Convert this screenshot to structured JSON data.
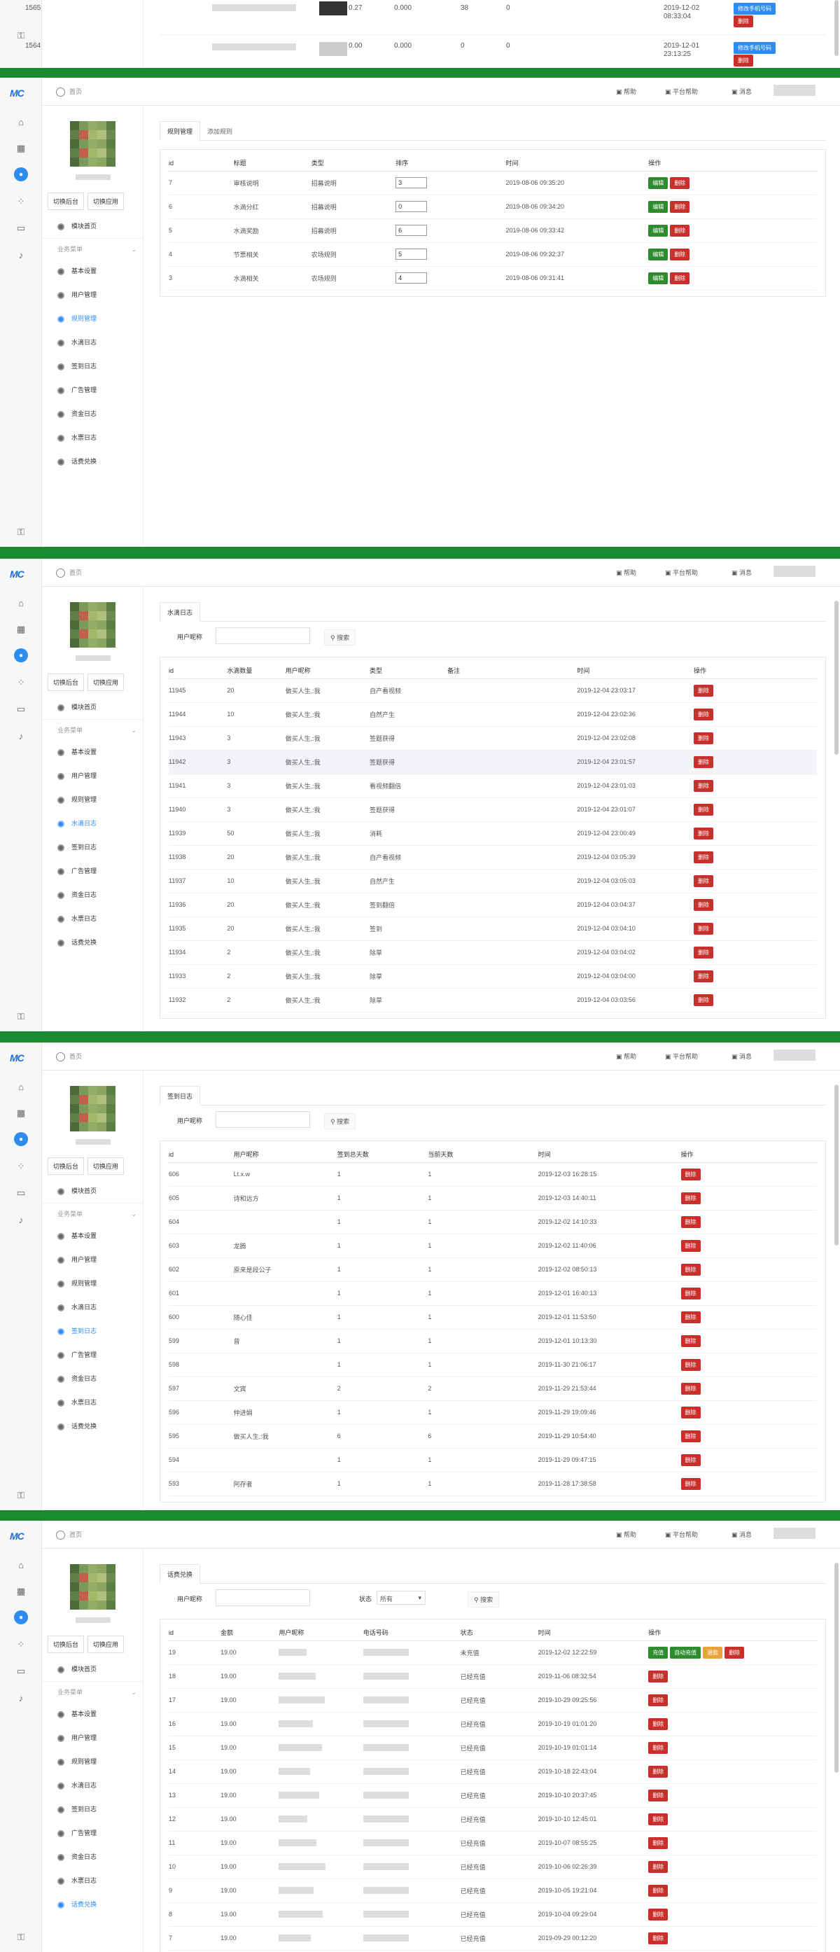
{
  "common": {
    "logo": "MC",
    "home": "首页",
    "help": "帮助",
    "platform_help": "平台帮助",
    "messages": "消息",
    "switch_frame": "切换后台",
    "switch_app": "切换应用",
    "module_list": "模块首页",
    "business_menu": "业务菜单",
    "menu": [
      "基本设置",
      "用户管理",
      "规则管理",
      "水滴日志",
      "签到日志",
      "广告管理",
      "资金日志",
      "水票日志",
      "话费兑换"
    ]
  },
  "top_strip": {
    "rows": [
      {
        "id": "1565",
        "c3": "0.27",
        "c4": "0.000",
        "c5": "38",
        "c6": "0",
        "date": "2019-12-02",
        "time": "08:33:04",
        "btn1": "修改手机号码",
        "btn2": "删除"
      },
      {
        "id": "1564",
        "c3": "0.00",
        "c4": "0.000",
        "c5": "0",
        "c6": "0",
        "date": "2019-12-01",
        "time": "23:13:25",
        "btn1": "修改手机号码",
        "btn2": "删除"
      }
    ]
  },
  "rules": {
    "tabs": [
      "规则管理",
      "添加规则"
    ],
    "headers": [
      "id",
      "标题",
      "类型",
      "排序",
      "时间",
      "操作"
    ],
    "rows": [
      {
        "id": "7",
        "title": "审核说明",
        "type": "招募说明",
        "sort": "3",
        "time": "2019-08-06 09:35:20"
      },
      {
        "id": "6",
        "title": "水滴分红",
        "type": "招募说明",
        "sort": "0",
        "time": "2019-08-06 09:34:20"
      },
      {
        "id": "5",
        "title": "水滴奖励",
        "type": "招募说明",
        "sort": "6",
        "time": "2019-08-06 09:33:42"
      },
      {
        "id": "4",
        "title": "节票相关",
        "type": "农场规则",
        "sort": "5",
        "time": "2019-08-06 09:32:37"
      },
      {
        "id": "3",
        "title": "水滴相关",
        "type": "农场规则",
        "sort": "4",
        "time": "2019-08-06 09:31:41"
      }
    ],
    "edit": "编辑",
    "del": "删除"
  },
  "waterlog": {
    "tab": "水滴日志",
    "search_label": "用户昵称",
    "search_btn": "搜索",
    "headers": [
      "id",
      "水滴数量",
      "用户昵称",
      "类型",
      "备注",
      "时间",
      "操作"
    ],
    "rows": [
      {
        "id": "11945",
        "num": "20",
        "user": "做买人生,:我",
        "type": "自产看视频",
        "time": "2019-12-04 23:03:17"
      },
      {
        "id": "11944",
        "num": "10",
        "user": "做买人生,:我",
        "type": "自然产生",
        "time": "2019-12-04 23:02:36"
      },
      {
        "id": "11943",
        "num": "3",
        "user": "做买人生,:我",
        "type": "签题获得",
        "time": "2019-12-04 23:02:08"
      },
      {
        "id": "11942",
        "num": "3",
        "user": "做买人生,:我",
        "type": "签题获得",
        "time": "2019-12-04 23:01:57"
      },
      {
        "id": "11941",
        "num": "3",
        "user": "做买人生,:我",
        "type": "看视频翻倍",
        "time": "2019-12-04 23:01:03"
      },
      {
        "id": "11940",
        "num": "3",
        "user": "做买人生,:我",
        "type": "签题获得",
        "time": "2019-12-04 23:01:07"
      },
      {
        "id": "11939",
        "num": "50",
        "user": "做买人生,:我",
        "type": "消耗",
        "time": "2019-12-04 23:00:49"
      },
      {
        "id": "11938",
        "num": "20",
        "user": "做买人生,:我",
        "type": "自产看视频",
        "time": "2019-12-04 03:05:39"
      },
      {
        "id": "11937",
        "num": "10",
        "user": "做买人生,:我",
        "type": "自然产生",
        "time": "2019-12-04 03:05:03"
      },
      {
        "id": "11936",
        "num": "20",
        "user": "做买人生,:我",
        "type": "签到翻倍",
        "time": "2019-12-04 03:04:37"
      },
      {
        "id": "11935",
        "num": "20",
        "user": "做买人生,:我",
        "type": "签到",
        "time": "2019-12-04 03:04:10"
      },
      {
        "id": "11934",
        "num": "2",
        "user": "做买人生,:我",
        "type": "除草",
        "time": "2019-12-04 03:04:02"
      },
      {
        "id": "11933",
        "num": "2",
        "user": "做买人生,:我",
        "type": "除草",
        "time": "2019-12-04 03:04:00"
      },
      {
        "id": "11932",
        "num": "2",
        "user": "做买人生,:我",
        "type": "除草",
        "time": "2019-12-04 03:03:56"
      }
    ],
    "del": "删除"
  },
  "signlog": {
    "tab": "签到日志",
    "search_label": "用户昵称",
    "search_btn": "搜索",
    "headers": [
      "id",
      "用户昵称",
      "签到总天数",
      "当前天数",
      "时间",
      "操作"
    ],
    "rows": [
      {
        "id": "606",
        "user": "Lt.x.w",
        "total": "1",
        "cur": "1",
        "time": "2019-12-03 16:28:15"
      },
      {
        "id": "605",
        "user": "诗和远方",
        "total": "1",
        "cur": "1",
        "time": "2019-12-03 14:40:11"
      },
      {
        "id": "604",
        "user": "",
        "total": "1",
        "cur": "1",
        "time": "2019-12-02 14:10:33"
      },
      {
        "id": "603",
        "user": "龙腾",
        "total": "1",
        "cur": "1",
        "time": "2019-12-02 11:40:06"
      },
      {
        "id": "602",
        "user": "原来是段公子",
        "total": "1",
        "cur": "1",
        "time": "2019-12-02 08:50:13"
      },
      {
        "id": "601",
        "user": "",
        "total": "1",
        "cur": "1",
        "time": "2019-12-01 16:40:13"
      },
      {
        "id": "600",
        "user": "随心佳",
        "total": "1",
        "cur": "1",
        "time": "2019-12-01 11:53:50"
      },
      {
        "id": "599",
        "user": "曾",
        "total": "1",
        "cur": "1",
        "time": "2019-12-01 10:13:30"
      },
      {
        "id": "598",
        "user": "",
        "total": "1",
        "cur": "1",
        "time": "2019-11-30 21:06:17"
      },
      {
        "id": "597",
        "user": "文宾",
        "total": "2",
        "cur": "2",
        "time": "2019-11-29 21:53:44"
      },
      {
        "id": "596",
        "user": "仲进娟",
        "total": "1",
        "cur": "1",
        "time": "2019-11-29 19:09:46"
      },
      {
        "id": "595",
        "user": "做买人生,:我",
        "total": "6",
        "cur": "6",
        "time": "2019-11-29 10:54:40"
      },
      {
        "id": "594",
        "user": "",
        "total": "1",
        "cur": "1",
        "time": "2019-11-29 09:47:15"
      },
      {
        "id": "593",
        "user": "阿存者",
        "total": "1",
        "cur": "1",
        "time": "2019-11-28 17:38:58"
      }
    ],
    "del": "删除"
  },
  "exchange": {
    "tab": "话费兑换",
    "search_label": "用户昵称",
    "state_label": "状态",
    "state_value": "所有",
    "search_btn": "搜索",
    "headers": [
      "id",
      "金额",
      "用户昵称",
      "电话号码",
      "状态",
      "时间",
      "操作"
    ],
    "rows": [
      {
        "id": "19",
        "amount": "19.00",
        "state": "未充值",
        "time": "2019-12-02 12:22:59"
      },
      {
        "id": "18",
        "amount": "19.00",
        "state": "已经充值",
        "time": "2019-11-06 08:32:54"
      },
      {
        "id": "17",
        "amount": "19.00",
        "state": "已经充值",
        "time": "2019-10-29 09:25:56"
      },
      {
        "id": "16",
        "amount": "19.00",
        "state": "已经充值",
        "time": "2019-10-19 01:01:20"
      },
      {
        "id": "15",
        "amount": "19.00",
        "state": "已经充值",
        "time": "2019-10-19 01:01:14"
      },
      {
        "id": "14",
        "amount": "19.00",
        "state": "已经充值",
        "time": "2019-10-18 22:43:04"
      },
      {
        "id": "13",
        "amount": "19.00",
        "state": "已经充值",
        "time": "2019-10-10 20:37:45"
      },
      {
        "id": "12",
        "amount": "19.00",
        "state": "已经充值",
        "time": "2019-10-10 12:45:01"
      },
      {
        "id": "11",
        "amount": "19.00",
        "state": "已经充值",
        "time": "2019-10-07 08:55:25"
      },
      {
        "id": "10",
        "amount": "19.00",
        "state": "已经充值",
        "time": "2019-10-06 02:26:39"
      },
      {
        "id": "9",
        "amount": "19.00",
        "state": "已经充值",
        "time": "2019-10-05 19:21:04"
      },
      {
        "id": "8",
        "amount": "19.00",
        "state": "已经充值",
        "time": "2019-10-04 09:29:04"
      },
      {
        "id": "7",
        "amount": "19.00",
        "state": "已经充值",
        "time": "2019-09-29 00:12:20"
      }
    ],
    "btn_charge": "充值",
    "btn_auto": "自动充值",
    "btn_refund": "退款",
    "del": "删除"
  },
  "colors": {
    "green_bar": "#1a8a2f",
    "primary": "#2d8cf0",
    "edit": "#2e8b2e",
    "delete": "#c9302c"
  }
}
